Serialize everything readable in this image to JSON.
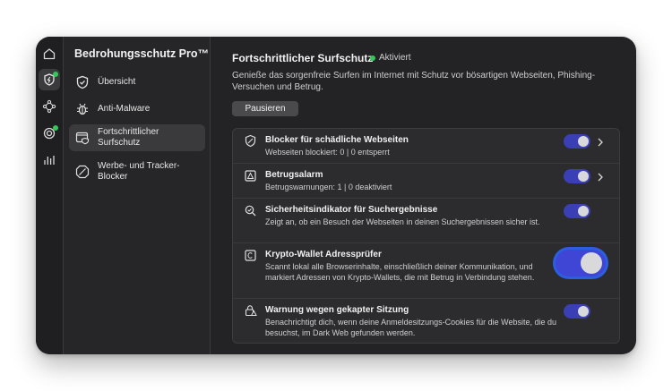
{
  "app": {
    "title": "Bedrohungsschutz Pro™"
  },
  "sidebar": {
    "items": [
      {
        "label": "Übersicht"
      },
      {
        "label": "Anti-Malware"
      },
      {
        "label": "Fortschrittlicher Surfschutz"
      },
      {
        "label": "Werbe- und Tracker-Blocker"
      }
    ]
  },
  "main": {
    "title": "Fortschrittlicher Surfschutz",
    "status": "Aktiviert",
    "description": "Genieße das sorgenfreie Surfen im Internet mit Schutz vor bösartigen Webseiten, Phishing-Versuchen und Betrug.",
    "pause_label": "Pausieren",
    "features": [
      {
        "title": "Blocker für schädliche Webseiten",
        "subtitle": "Webseiten blockiert: 0 | 0 entsperrt",
        "enabled": true
      },
      {
        "title": "Betrugsalarm",
        "subtitle": "Betrugswarnungen: 1 | 0 deaktiviert",
        "enabled": true
      },
      {
        "title": "Sicherheitsindikator für Suchergebnisse",
        "subtitle": "Zeigt an, ob ein Besuch der Webseiten in deinen Suchergebnissen sicher ist.",
        "enabled": true
      },
      {
        "title": "Krypto-Wallet Adressprüfer",
        "subtitle": "Scannt lokal alle Browserinhalte, einschließlich deiner Kommunikation, und markiert Adressen von Krypto-Wallets, die mit Betrug in Verbindung stehen.",
        "enabled": true
      },
      {
        "title": "Warnung wegen gekapter Sitzung",
        "subtitle": "Benachrichtigt dich, wenn deine Anmeldesitzungs-Cookies für die Website, die du besuchst, im Dark Web gefunden werden.",
        "enabled": true
      }
    ]
  },
  "colors": {
    "accent": "#3f46d6",
    "status_green": "#34c759",
    "window_bg": "#232325"
  }
}
